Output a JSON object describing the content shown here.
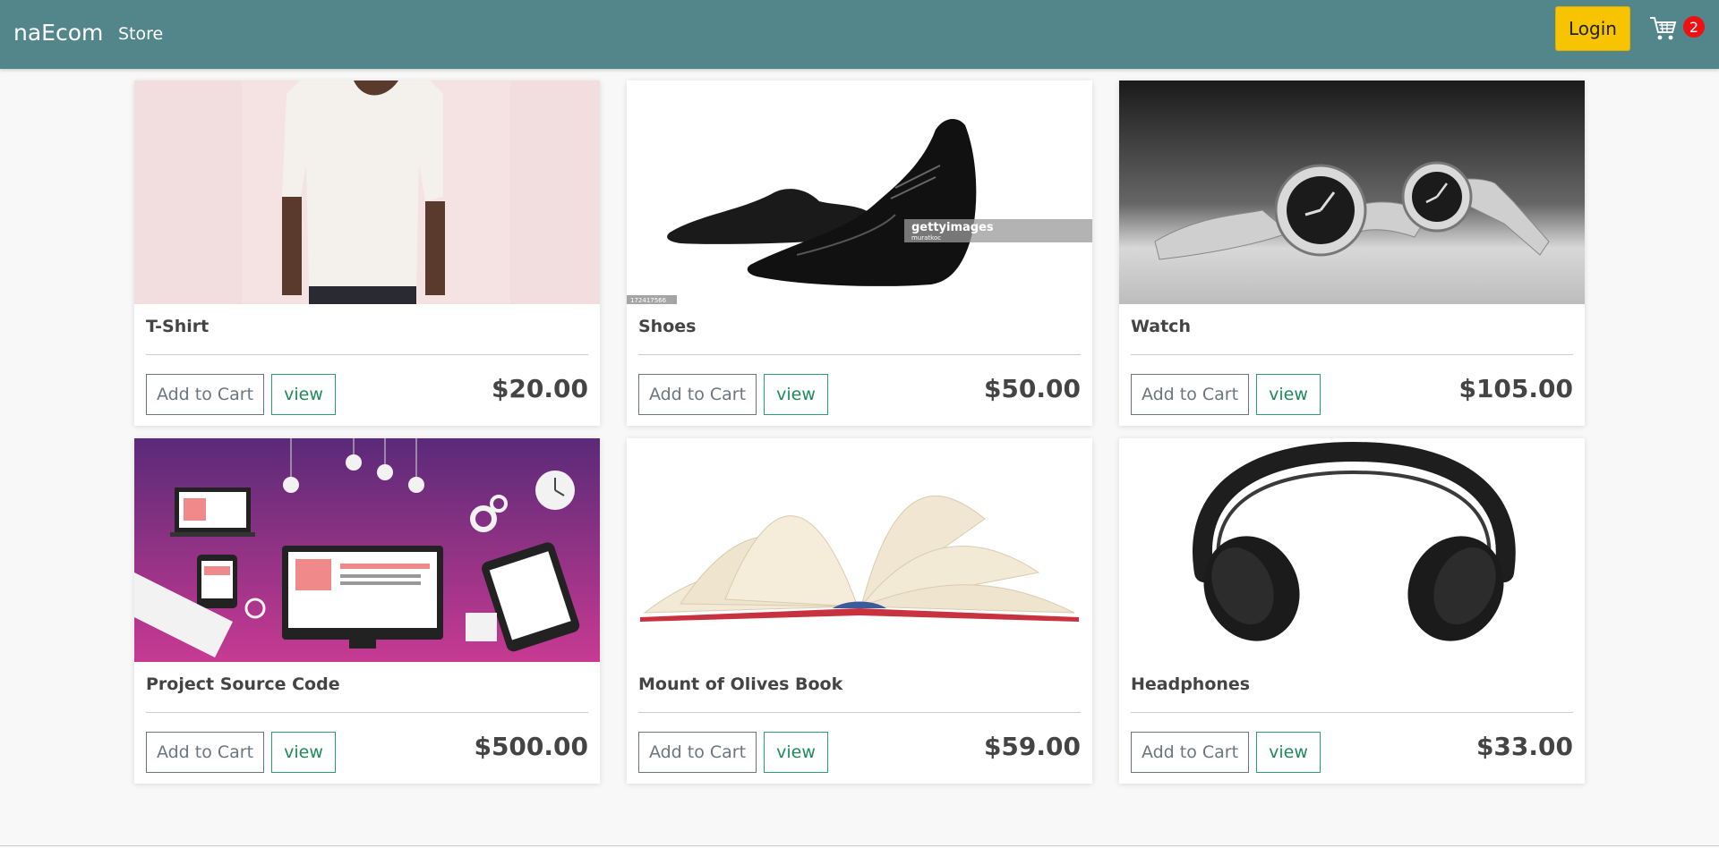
{
  "navbar": {
    "brand": "naEcom",
    "store_link": "Store",
    "login_label": "Login",
    "cart_count": "2",
    "accent_color": "#52868b",
    "login_color": "#f8c300"
  },
  "products": [
    {
      "name": "T-Shirt",
      "price": "$20.00",
      "add_label": "Add to Cart",
      "view_label": "view",
      "image_icon": "tshirt-photo"
    },
    {
      "name": "Shoes",
      "price": "$50.00",
      "add_label": "Add to Cart",
      "view_label": "view",
      "image_icon": "shoes-photo",
      "watermark": "gettyimages",
      "watermark_credit": "muratkoc",
      "image_id": "172417566"
    },
    {
      "name": "Watch",
      "price": "$105.00",
      "add_label": "Add to Cart",
      "view_label": "view",
      "image_icon": "watch-photo"
    },
    {
      "name": "Project Source Code",
      "price": "$500.00",
      "add_label": "Add to Cart",
      "view_label": "view",
      "image_icon": "devices-illustration"
    },
    {
      "name": "Mount of Olives Book",
      "price": "$59.00",
      "add_label": "Add to Cart",
      "view_label": "view",
      "image_icon": "book-photo"
    },
    {
      "name": "Headphones",
      "price": "$33.00",
      "add_label": "Add to Cart",
      "view_label": "view",
      "image_icon": "headphones-photo"
    }
  ]
}
